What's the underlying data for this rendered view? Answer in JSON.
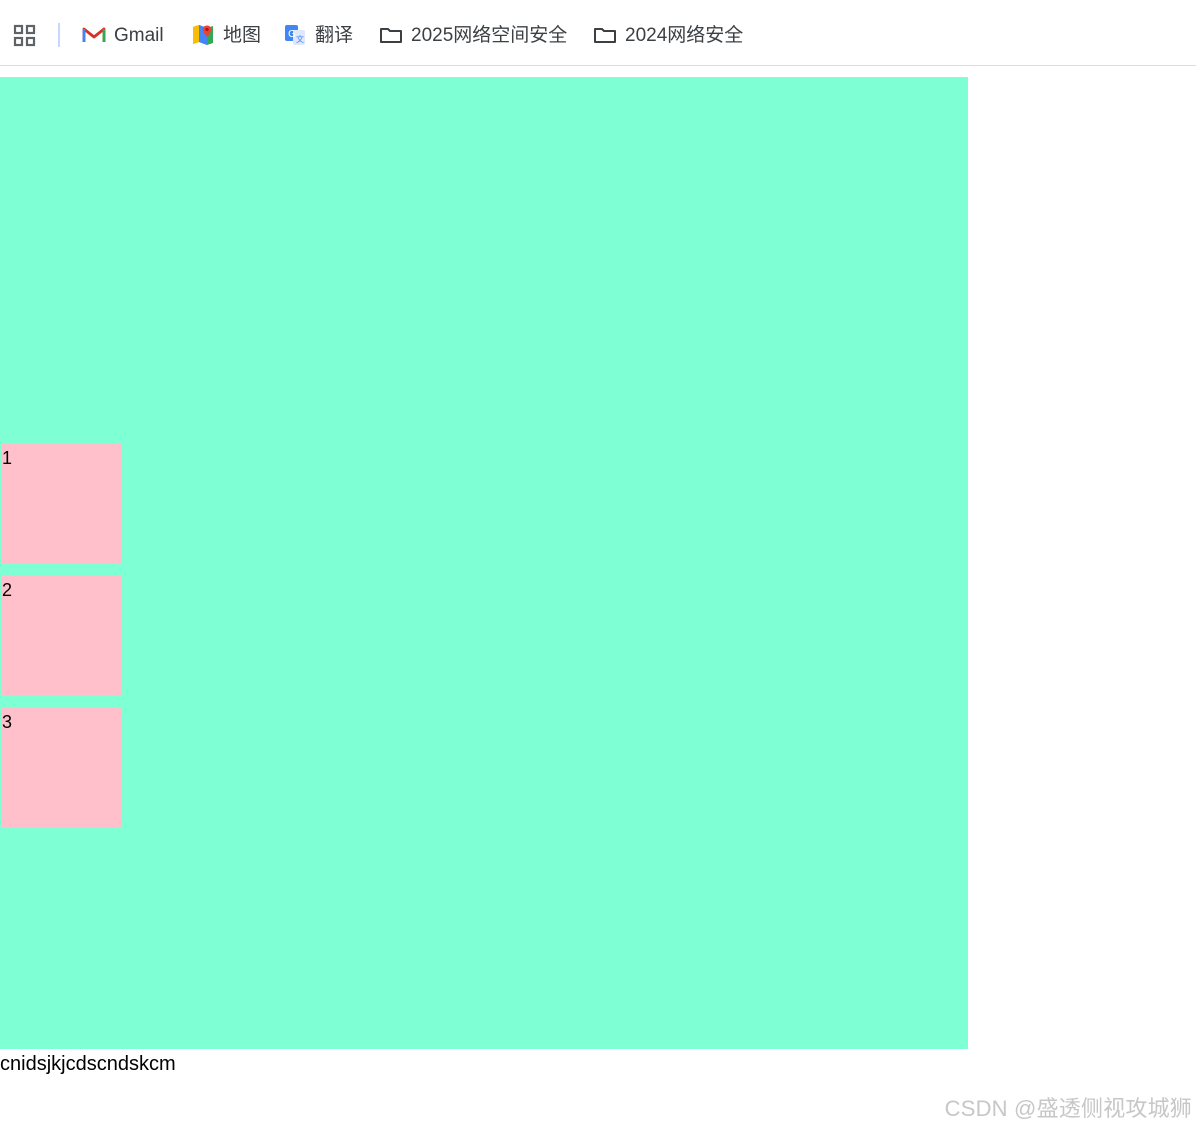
{
  "bookmarks": {
    "items": [
      {
        "label": "Gmail",
        "icon": "gmail-icon"
      },
      {
        "label": "地图",
        "icon": "maps-icon"
      },
      {
        "label": "翻译",
        "icon": "translate-icon"
      },
      {
        "label": "2025网络空间安全",
        "icon": "folder-icon"
      },
      {
        "label": "2024网络安全",
        "icon": "folder-icon"
      }
    ]
  },
  "content": {
    "boxes": [
      {
        "label": "1"
      },
      {
        "label": "2"
      },
      {
        "label": "3"
      }
    ],
    "footer_text": "cnidsjkjcdscndskcm"
  },
  "watermark": "CSDN @盛透侧视攻城狮",
  "colors": {
    "canvas": "#7fffd4",
    "box": "#ffc0cb",
    "page_background": "#ffffff"
  }
}
